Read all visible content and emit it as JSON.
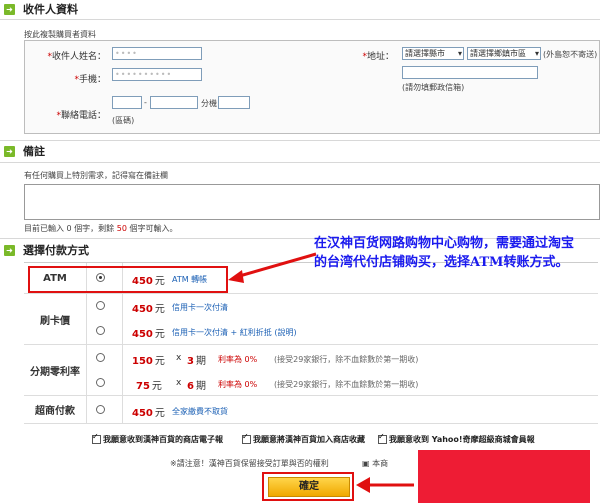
{
  "recipient": {
    "title": "收件人資料",
    "copy_link": "按此複製購買者資料",
    "name_label": "收件人姓名：",
    "name_value": "••••",
    "mobile_label": "手機：",
    "mobile_value": "••••••••••",
    "phone_label": "聯絡電話：",
    "phone_sep": "-",
    "ext_label": "分機",
    "area_code_label": "(區碼)",
    "address_label": "地址：",
    "city_select": "請選擇縣市",
    "district_select": "請選擇鄉鎮市區",
    "address_note": "(外島恕不寄送)",
    "address_hint": "(請勿填郵政信箱)"
  },
  "remarks": {
    "title": "備註",
    "prompt": "有任何購買上特別需求，記得寫在備註欄",
    "counter_prefix": "目前已輸入",
    "counter_used": "0",
    "counter_mid": "個字，剩餘",
    "counter_left": "50",
    "counter_suffix": "個字可輸入。"
  },
  "payment": {
    "title": "選擇付款方式",
    "methods": [
      {
        "name": "ATM",
        "price": "450",
        "unit": "元",
        "desc": "ATM 轉帳"
      },
      {
        "name": "刷卡價",
        "price": "450",
        "unit": "元",
        "desc": "信用卡一次付清"
      },
      {
        "name": "",
        "price": "450",
        "unit": "元",
        "desc": "信用卡一次付清 + 紅利折抵 (說明)"
      },
      {
        "name": "分期零利率",
        "price": "150",
        "unit": "元",
        "mult": "x",
        "periods": "3",
        "period_unit": "期",
        "rate": "利率為 0%",
        "note": "(接受29家銀行，除不血餘數於第一期收)"
      },
      {
        "name": "",
        "price": "75",
        "unit": "元",
        "mult": "x",
        "periods": "6",
        "period_unit": "期",
        "rate": "利率為 0%",
        "note": "(接受29家銀行，除不血餘數於第一期收)"
      },
      {
        "name": "超商付款",
        "price": "450",
        "unit": "元",
        "desc": "全家繳費不取貨"
      }
    ]
  },
  "agreements": {
    "a1": "我願意收到漢神百貨的商店電子報",
    "a2": "我願意將漢神百貨加入商店收藏",
    "a3": "我願意收到 Yahoo!奇摩超級商城會員報"
  },
  "notice": {
    "text": "※請注意！漢神百貨保留接受訂單與否的權利",
    "link": "本商"
  },
  "confirm_label": "確定",
  "callout": "在汉神百货网路购物中心购物，需要通过淘宝的台湾代付店铺购买，选择ATM转账方式。",
  "colors": {
    "accent_green": "#7ab929",
    "highlight_red": "#e01010",
    "callout_blue": "#1a1aee"
  }
}
